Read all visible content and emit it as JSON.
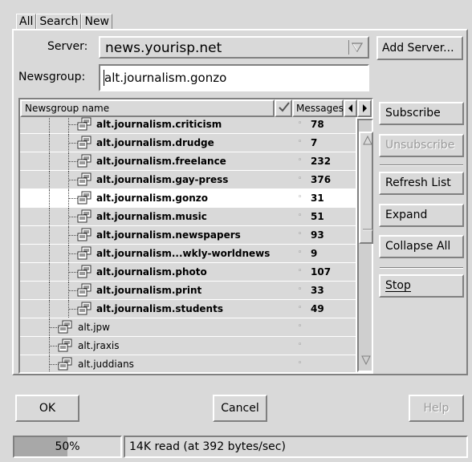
{
  "tabs": [
    "All",
    "Search",
    "New"
  ],
  "server": {
    "label": "Server:",
    "value": "news.yourisp.net"
  },
  "newsgroup": {
    "label": "Newsgroup:",
    "value": "alt.journalism.gonzo"
  },
  "buttons": {
    "add_server": "Add Server...",
    "subscribe": "Subscribe",
    "unsubscribe": "Unsubscribe",
    "refresh_list": "Refresh List",
    "expand": "Expand",
    "collapse_all": "Collapse All",
    "stop": "Stop",
    "ok": "OK",
    "cancel": "Cancel",
    "help": "Help"
  },
  "list": {
    "columns": {
      "name": "Newsgroup name",
      "messages": "Messages"
    },
    "rows": [
      {
        "name": "alt.journalism.criticism",
        "messages": "78",
        "bold": true
      },
      {
        "name": "alt.journalism.drudge",
        "messages": "7",
        "bold": true
      },
      {
        "name": "alt.journalism.freelance",
        "messages": "232",
        "bold": true
      },
      {
        "name": "alt.journalism.gay-press",
        "messages": "376",
        "bold": true
      },
      {
        "name": "alt.journalism.gonzo",
        "messages": "31",
        "bold": true,
        "selected": true
      },
      {
        "name": "alt.journalism.music",
        "messages": "51",
        "bold": true
      },
      {
        "name": "alt.journalism.newspapers",
        "messages": "93",
        "bold": true
      },
      {
        "name": "alt.journalism...wkly-worldnews",
        "messages": "9",
        "bold": true
      },
      {
        "name": "alt.journalism.photo",
        "messages": "107",
        "bold": true
      },
      {
        "name": "alt.journalism.print",
        "messages": "33",
        "bold": true
      },
      {
        "name": "alt.journalism.students",
        "messages": "49",
        "bold": true
      },
      {
        "name": "alt.jpw",
        "messages": "",
        "bold": false
      },
      {
        "name": "alt.jraxis",
        "messages": "",
        "bold": false
      },
      {
        "name": "alt.juddians",
        "messages": "",
        "bold": false
      }
    ]
  },
  "status": {
    "progress_text": "50%",
    "progress": 0.5,
    "message": "14K read (at 392 bytes/sec)"
  },
  "icons": {
    "combo_arrow": "dropdown-arrow-icon",
    "subscribed_column": "checkmark-icon",
    "scroll_left": "left-arrow-icon",
    "scroll_right": "right-arrow-icon",
    "newsgroup": "newsgroup-icon"
  }
}
